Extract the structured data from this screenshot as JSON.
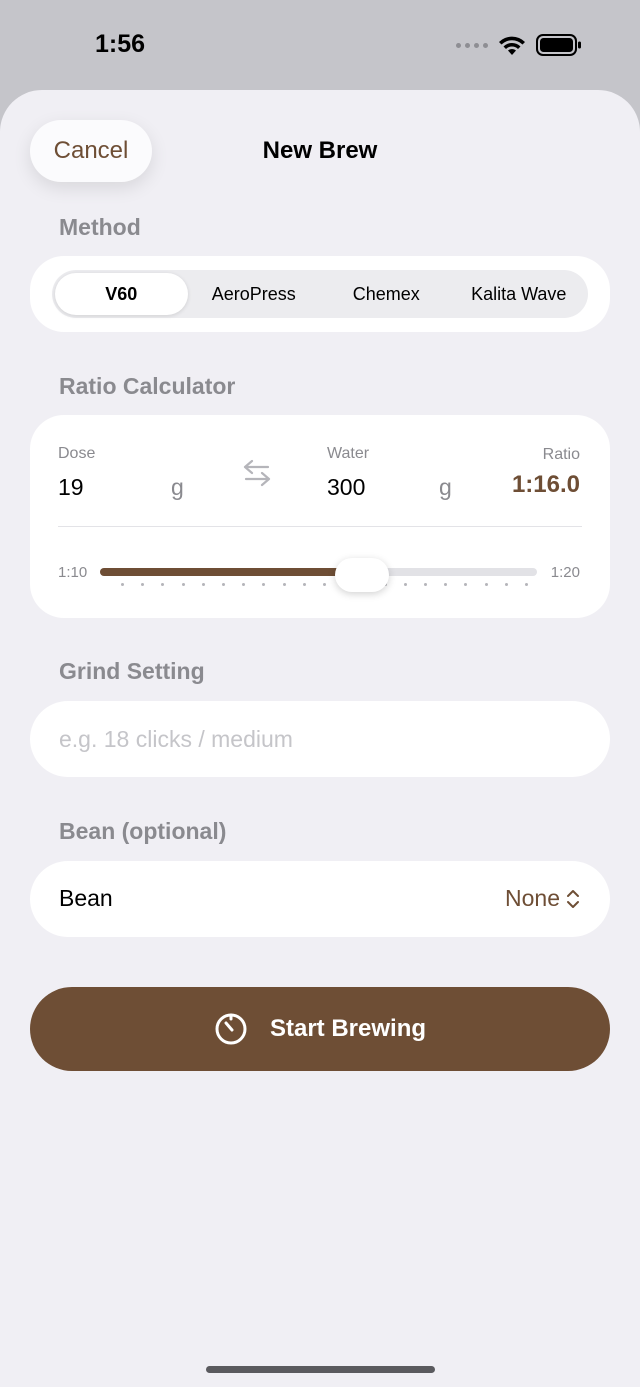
{
  "status_bar": {
    "time": "1:56"
  },
  "header": {
    "cancel_label": "Cancel",
    "title": "New Brew"
  },
  "method": {
    "section_label": "Method",
    "options": [
      "V60",
      "AeroPress",
      "Chemex",
      "Kalita Wave"
    ],
    "selected": "V60"
  },
  "ratio_calculator": {
    "section_label": "Ratio Calculator",
    "dose_label": "Dose",
    "dose_value": "19",
    "dose_unit": "g",
    "water_label": "Water",
    "water_value": "300",
    "water_unit": "g",
    "ratio_label": "Ratio",
    "ratio_value": "1:16.0",
    "slider_min_label": "1:10",
    "slider_max_label": "1:20",
    "slider_min": 10,
    "slider_max": 20,
    "slider_value": 16.0
  },
  "grind": {
    "section_label": "Grind Setting",
    "placeholder": "e.g. 18 clicks / medium",
    "value": ""
  },
  "bean": {
    "section_label": "Bean (optional)",
    "label": "Bean",
    "value": "None"
  },
  "start_button": {
    "label": "Start Brewing"
  },
  "colors": {
    "accent": "#6e4e35",
    "background": "#f0eff4",
    "card": "#ffffff"
  },
  "icons": [
    "wifi-icon",
    "battery-icon",
    "swap-arrows-icon",
    "chevron-up-down-icon",
    "timer-icon"
  ]
}
